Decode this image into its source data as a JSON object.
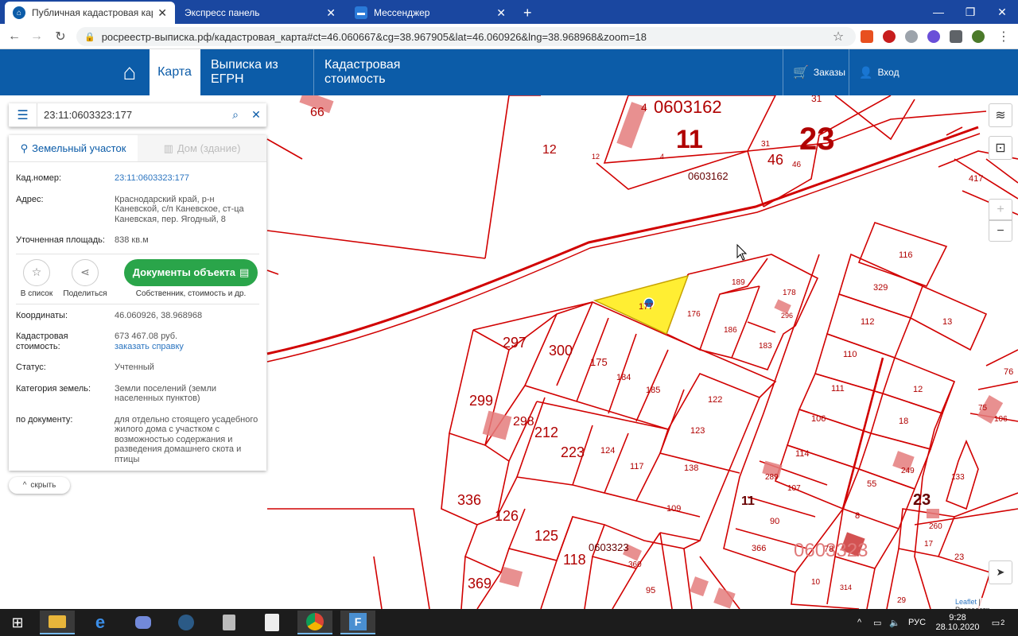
{
  "browser": {
    "tabs": [
      {
        "title": "Публичная кадастровая карта 2",
        "active": true
      },
      {
        "title": "Экспресс панель",
        "active": false
      },
      {
        "title": "Мессенджер",
        "active": false
      }
    ],
    "new_tab": "+",
    "minimize": "—",
    "maximize": "❐",
    "close": "✕",
    "url": "росреестр-выписка.рф/кадастровая_карта#ct=46.060667&cg=38.967905&lat=46.060926&lng=38.968968&zoom=18",
    "back_icon": "←",
    "forward_icon": "→",
    "reload_icon": "↻",
    "star_icon": "☆",
    "menu_icon": "⋮"
  },
  "site": {
    "nav": [
      {
        "label": "Карта",
        "active": true
      },
      {
        "label": "Выписка из ЕГРН",
        "active": false
      },
      {
        "label": "Кадастровая стоимость",
        "active": false
      }
    ],
    "orders_label": "Заказы",
    "login_label": "Вход"
  },
  "panel": {
    "search_value": "23:11:0603323:177",
    "tab_land": "Земельный участок",
    "tab_house": "Дом (здание)",
    "fields": {
      "cad_key": "Кад.номер:",
      "cad_val": "23:11:0603323:177",
      "addr_key": "Адрес:",
      "addr_val": "Краснодарский край, р-н Каневской, с/п Каневское, ст-ца Каневская, пер. Ягодный, 8",
      "area_key": "Уточненная площадь:",
      "area_val": "838 кв.м",
      "coords_key": "Координаты:",
      "coords_val": "46.060926, 38.968968",
      "cost_key": "Кадастровая стоимость:",
      "cost_val": "673 467.08 руб.",
      "cost_link": "заказать справку",
      "status_key": "Статус:",
      "status_val": "Учтенный",
      "cat_key": "Категория земель:",
      "cat_val": "Земли поселений (земли населенных пунктов)",
      "doc_key": "по документу:",
      "doc_val": "для отдельно стоящего усадебного жилого дома с участком с возможностью содержания и разведения домашнего скота и птицы"
    },
    "actions": {
      "list_label": "В список",
      "share_label": "Поделиться",
      "docs_label": "Документы объекта",
      "docs_sub": "Собственник, стоимость и др."
    },
    "hide_label": "скрыть"
  },
  "map": {
    "labels": {
      "q1": "0603162",
      "q2": "0603162",
      "q3": "0603323",
      "q4": "0603323",
      "big11a": "11",
      "big23a": "23",
      "big11b": "11",
      "big23b": "23",
      "p66": "66",
      "p4": "4",
      "p12": "12",
      "p12b": "12",
      "p4b": "4",
      "p31": "31",
      "p31b": "31",
      "p46": "46",
      "p46b": "46",
      "p417": "417",
      "p116": "116",
      "p189": "189",
      "p178": "178",
      "p296": "296",
      "p176": "176",
      "p186": "186",
      "p183": "183",
      "p177": "177",
      "p297": "297",
      "p300": "300",
      "p175": "175",
      "p184": "184",
      "p185": "185",
      "p122": "122",
      "p329": "329",
      "p112": "112",
      "p13": "13",
      "p110": "110",
      "p111": "111",
      "p12c": "12",
      "p299": "299",
      "p298": "298",
      "p212": "212",
      "p223": "223",
      "p124": "124",
      "p123": "123",
      "p106": "106",
      "p18": "18",
      "p114": "114",
      "p249": "249",
      "p117": "117",
      "p138": "138",
      "p289": "289",
      "p107": "107",
      "p55": "55",
      "p133": "133",
      "p336": "336",
      "p126": "126",
      "p109": "109",
      "p90": "90",
      "p8": "8",
      "p260": "260",
      "p125": "125",
      "p118": "118",
      "p360": "360",
      "p366": "366",
      "p78": "78",
      "p17": "17",
      "p23": "23",
      "p369": "369",
      "p10": "10",
      "p314": "314",
      "p29": "29",
      "p95": "95",
      "p76": "76",
      "p75": "75",
      "p106b": "106"
    },
    "zoom_in": "+",
    "zoom_out": "−",
    "attribution_leaflet": "Leaflet",
    "attribution_rest": " | Росреестр"
  },
  "taskbar": {
    "lang": "РУС",
    "time": "9:28",
    "date": "28.10.2020",
    "notif": "2"
  },
  "colors": {
    "header_blue": "#0c5ca8",
    "green": "#2aa54a",
    "parcel_red": "#d10000",
    "selected_yellow": "#ffee33"
  }
}
